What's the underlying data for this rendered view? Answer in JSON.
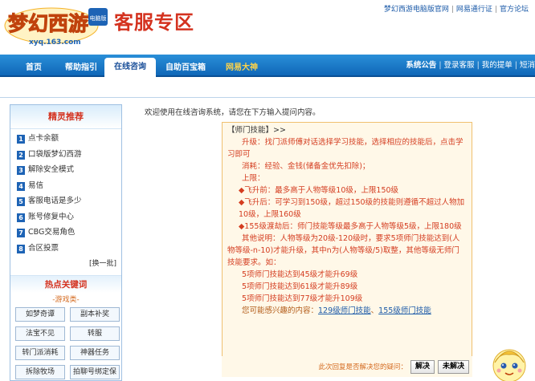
{
  "header": {
    "logo_text": "梦幻西游",
    "logo_badge": "电脑版",
    "logo_url_text": "xyq.163.com",
    "zone_title": "客服专区",
    "top_links": [
      "梦幻西游电脑版官网",
      "网易通行证",
      "官方论坛"
    ]
  },
  "nav": {
    "tabs": [
      "首页",
      "帮助指引",
      "在线咨询",
      "自助百宝箱",
      "网易大神"
    ],
    "right_links": [
      "系统公告",
      "登录客服",
      "我的提单",
      "短消"
    ]
  },
  "sidebar": {
    "title": "精灵推荐",
    "items": [
      {
        "num": "1",
        "label": "点卡余额"
      },
      {
        "num": "2",
        "label": "口袋版梦幻西游"
      },
      {
        "num": "3",
        "label": "解除安全模式"
      },
      {
        "num": "4",
        "label": "易信"
      },
      {
        "num": "5",
        "label": "客服电话是多少"
      },
      {
        "num": "6",
        "label": "账号修复中心"
      },
      {
        "num": "7",
        "label": "CBG交易角色"
      },
      {
        "num": "8",
        "label": "合区投票"
      }
    ],
    "change_batch": "[换一批]",
    "hot_title": "热点关键词",
    "game_label": "-游戏类-",
    "keywords": [
      "如梦奇谭",
      "副本补奖",
      "法宝不见",
      "转服",
      "转门派消耗",
      "神器任务",
      "拆除牧场",
      "拍聊号绑定保"
    ]
  },
  "main": {
    "welcome": "欢迎使用在线咨询系统，请您在下方输入提问内容。",
    "answer": {
      "title": "【师门技能】>>",
      "lines": [
        "升级：找门派师傅对话选择学习技能，选择相应的技能后，点击学习即可",
        "消耗：经验、金钱(储备金优先扣除)；",
        "上限：",
        "◆飞升前：最多高于人物等级10级，上限150级",
        "◆飞升后：可学习到150级，超过150级的技能则遵循不超过人物加10级，上限160级",
        "◆155级渡劫后：师门技能等级最多高于人物等级5级，上限180级",
        "其他说明：人物等级为20级-120级时，要求5项师门技能达到(人物等级-n-10)才能升级，其中n为(人物等级/5)取整，其他等级无师门技能要求。如：",
        "5项师门技能达到45级才能升69级",
        "5项师门技能达到61级才能升89级",
        "5项师门技能达到77级才能升109级"
      ],
      "related_prefix": "您可能感兴趣的内容：",
      "related_links": [
        "129级师门技能",
        "155级师门技能"
      ]
    },
    "feedback": {
      "question": "此次回复是否解决您的疑问：",
      "resolved": "解决",
      "unresolved": "未解决"
    }
  },
  "colors": {
    "nav_blue": "#1672c6",
    "accent_red": "#d4321f",
    "answer_bg": "#fff8e8"
  }
}
